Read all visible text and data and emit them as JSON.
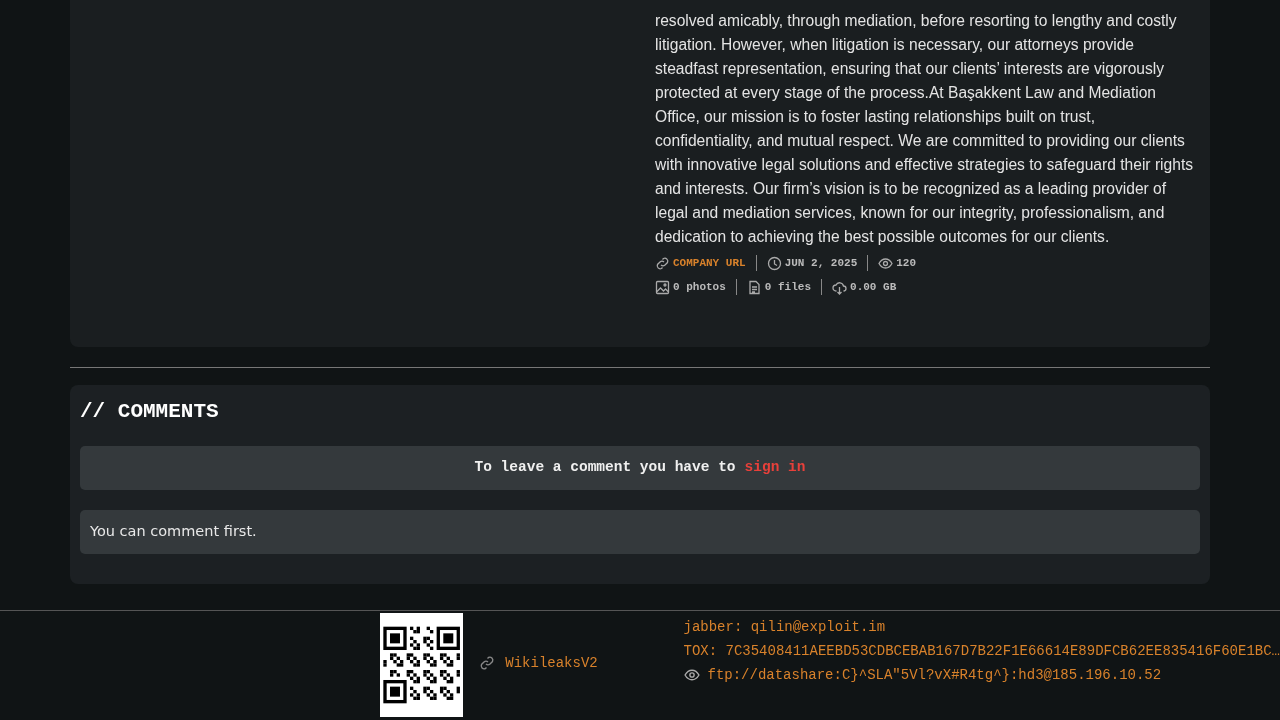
{
  "post": {
    "description": "resolved amicably, through mediation, before resorting to lengthy and costly litigation. However, when litigation is necessary, our attorneys provide steadfast representation, ensuring that our clients’ interests are vigorously protected at every stage of the process.At Başakkent Law and Mediation Office, our mission is to foster lasting relationships built on trust, confidentiality, and mutual respect. We are committed to providing our clients with innovative legal solutions and effective strategies to safeguard their rights and interests. Our firm’s vision is to be recognized as a leading provider of legal and mediation services, known for our integrity, professionalism, and dedication to achieving the best possible outcomes for our clients.",
    "meta_rows": [
      [
        {
          "kind": "link",
          "text": "COMPANY URL"
        },
        {
          "kind": "date",
          "text": "JUN 2, 2025"
        },
        {
          "kind": "views",
          "text": "120"
        }
      ],
      [
        {
          "kind": "photos",
          "text": "0 photos"
        },
        {
          "kind": "files",
          "text": "0 files"
        },
        {
          "kind": "size",
          "text": "0.00 GB"
        }
      ]
    ]
  },
  "comments": {
    "title": "// COMMENTS",
    "notice": "To leave a comment you have to",
    "notice_link": "sign in",
    "empty": "You can comment first."
  },
  "footer": {
    "link": "WikileaksV2",
    "contacts": [
      {
        "kind": "text",
        "text": "jabber: qilin@exploit.im"
      },
      {
        "kind": "text",
        "text": "TOX: 7C35408411AEEBD53CDBCEBAB167D7B22F1E66614E89DFCB62EE835416F60E1BC…"
      },
      {
        "kind": "eye",
        "text": "ftp://datashare:C}^SLA\"5Vl?vX#R4tg^}:hd3@185.196.10.52"
      }
    ]
  }
}
